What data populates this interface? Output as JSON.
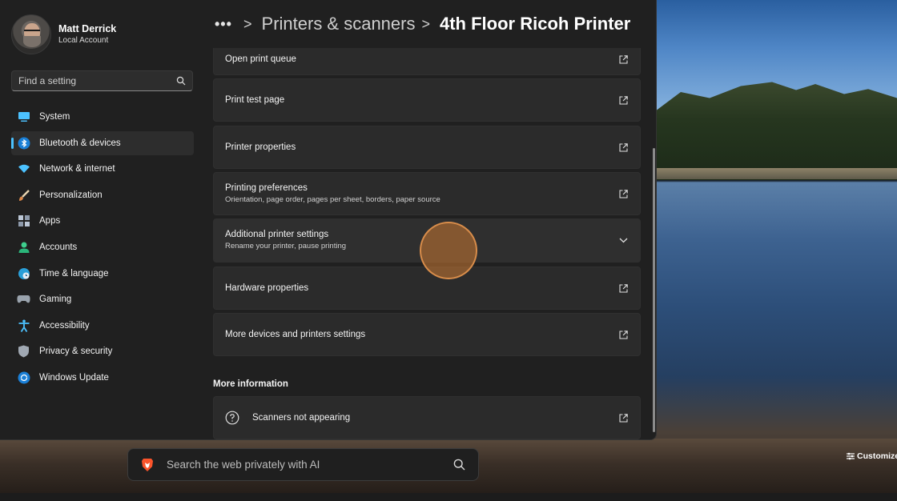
{
  "user": {
    "name": "Matt Derrick",
    "account_type": "Local Account"
  },
  "search": {
    "placeholder": "Find a setting"
  },
  "sidebar": {
    "items": [
      {
        "label": "System",
        "icon": "system-icon"
      },
      {
        "label": "Bluetooth & devices",
        "icon": "bluetooth-icon",
        "active": true
      },
      {
        "label": "Network & internet",
        "icon": "wifi-icon"
      },
      {
        "label": "Personalization",
        "icon": "brush-icon"
      },
      {
        "label": "Apps",
        "icon": "apps-icon"
      },
      {
        "label": "Accounts",
        "icon": "person-icon"
      },
      {
        "label": "Time & language",
        "icon": "globe-clock-icon"
      },
      {
        "label": "Gaming",
        "icon": "gamepad-icon"
      },
      {
        "label": "Accessibility",
        "icon": "accessibility-icon"
      },
      {
        "label": "Privacy & security",
        "icon": "shield-icon"
      },
      {
        "label": "Windows Update",
        "icon": "update-icon"
      }
    ]
  },
  "breadcrumb": {
    "more": "•••",
    "separator": ">",
    "crumb": "Printers & scanners",
    "current": "4th Floor Ricoh Printer"
  },
  "settings_list": [
    {
      "title": "Open print queue",
      "description": "",
      "action": "external-link-icon"
    },
    {
      "title": "Print test page",
      "description": "",
      "action": "external-link-icon"
    },
    {
      "title": "Printer properties",
      "description": "",
      "action": "external-link-icon"
    },
    {
      "title": "Printing preferences",
      "description": "Orientation, page order, pages per sheet, borders, paper source",
      "action": "external-link-icon"
    },
    {
      "title": "Additional printer settings",
      "description": "Rename your printer, pause printing",
      "action": "chevron-down-icon"
    },
    {
      "title": "Hardware properties",
      "description": "",
      "action": "external-link-icon"
    },
    {
      "title": "More devices and printers settings",
      "description": "",
      "action": "external-link-icon"
    }
  ],
  "more_information": {
    "heading": "More information",
    "items": [
      {
        "title": "Scanners not appearing",
        "icon": "help-icon",
        "action": "external-link-icon"
      }
    ]
  },
  "web_search": {
    "placeholder": "Search the web privately with AI"
  },
  "desktop": {
    "customize_label": "Customize"
  },
  "colors": {
    "accent": "#4cc2ff",
    "window_bg": "#202020",
    "card_bg": "#2b2b2b"
  }
}
